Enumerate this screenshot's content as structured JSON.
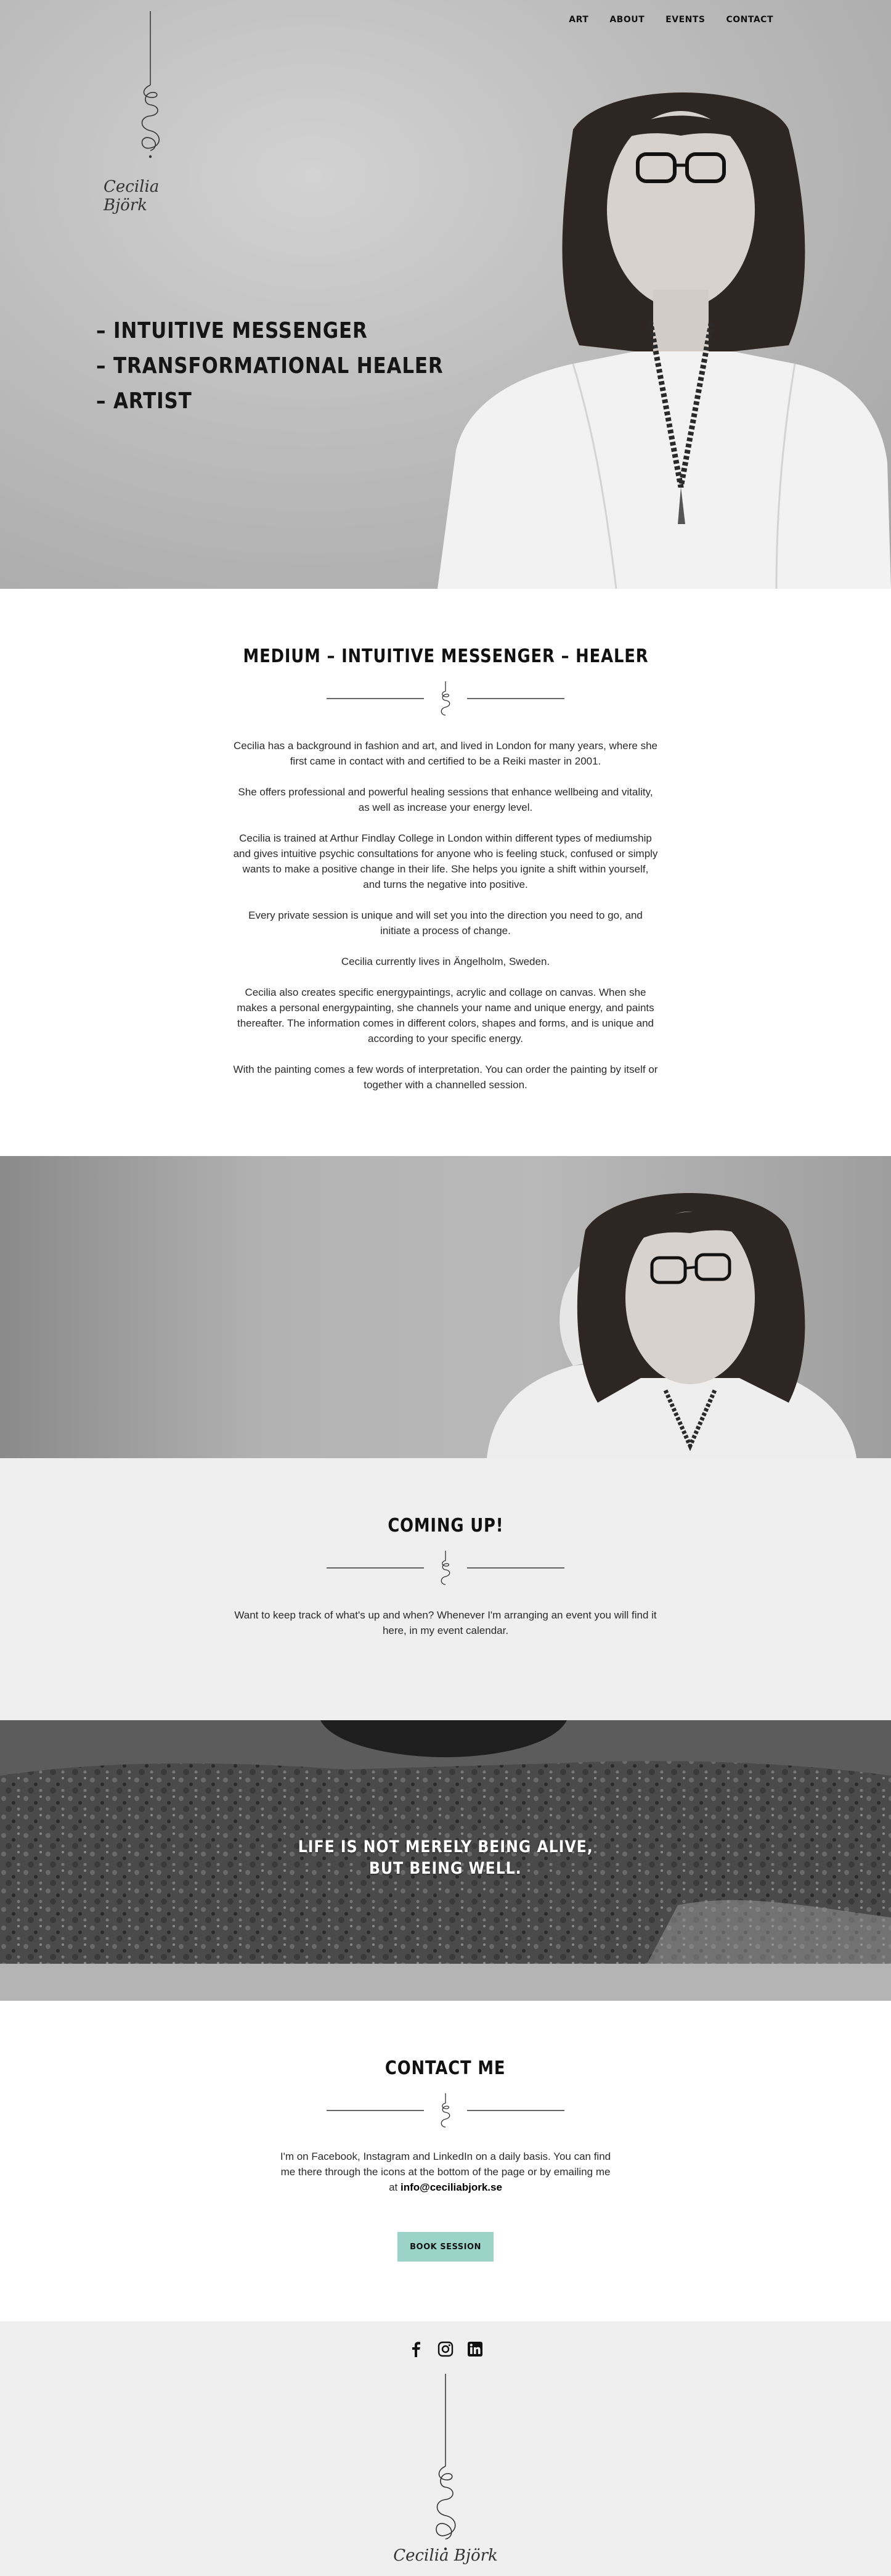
{
  "brand": {
    "name": "Cecilia Björk"
  },
  "nav": {
    "items": [
      {
        "label": "ART"
      },
      {
        "label": "ABOUT"
      },
      {
        "label": "EVENTS"
      },
      {
        "label": "CONTACT"
      }
    ]
  },
  "hero": {
    "lines": [
      "– INTUITIVE MESSENGER",
      "– TRANSFORMATIONAL HEALER",
      "– ARTIST"
    ]
  },
  "intro": {
    "title": "MEDIUM – INTUITIVE MESSENGER – HEALER",
    "paragraphs": [
      "Cecilia has a background in fashion and art, and lived in London for many years, where she first came in contact with and certified to be a Reiki master in 2001.",
      "She offers professional and powerful healing sessions that enhance wellbeing and vitality, as well as increase your energy level.",
      "Cecilia is trained at Arthur Findlay College in London within different types of mediumship and gives intuitive psychic consultations for anyone who is feeling stuck, confused or simply wants to make a positive change in their life. She helps you ignite a shift within yourself, and turns the negative into positive.",
      "Every private session is unique and will set you into the direction you need to go, and initiate a process of change.",
      "Cecilia currently lives in Ängelholm, Sweden.",
      "Cecilia also creates specific energypaintings, acrylic and collage on canvas. When she makes a personal energypainting, she channels your name and unique energy, and paints thereafter. The information comes in different colors, shapes and forms, and is unique and according to your specific energy.",
      "With the painting comes a few words of interpretation. You can order the painting by itself or together with a channelled session."
    ]
  },
  "coming_up": {
    "title": "COMING UP!",
    "text": "Want to keep track of what's up and when? Whenever I'm arranging an event you will find it here, in my event calendar."
  },
  "quote": {
    "line1": "LIFE IS NOT MERELY BEING ALIVE,",
    "line2": "BUT BEING WELL."
  },
  "contact": {
    "title": "CONTACT ME",
    "text": "I'm on Facebook, Instagram and LinkedIn on a daily basis. You can find me there through the icons at the bottom of the page or by emailing me at",
    "email": "info@ceciliabjork.se",
    "button_label": "BOOK SESSION",
    "button_color": "#9cd3c9"
  },
  "footer": {
    "social": [
      {
        "icon": "facebook-icon"
      },
      {
        "icon": "instagram-icon"
      },
      {
        "icon": "linkedin-icon"
      }
    ],
    "brand_name": "Cecilia Björk"
  }
}
